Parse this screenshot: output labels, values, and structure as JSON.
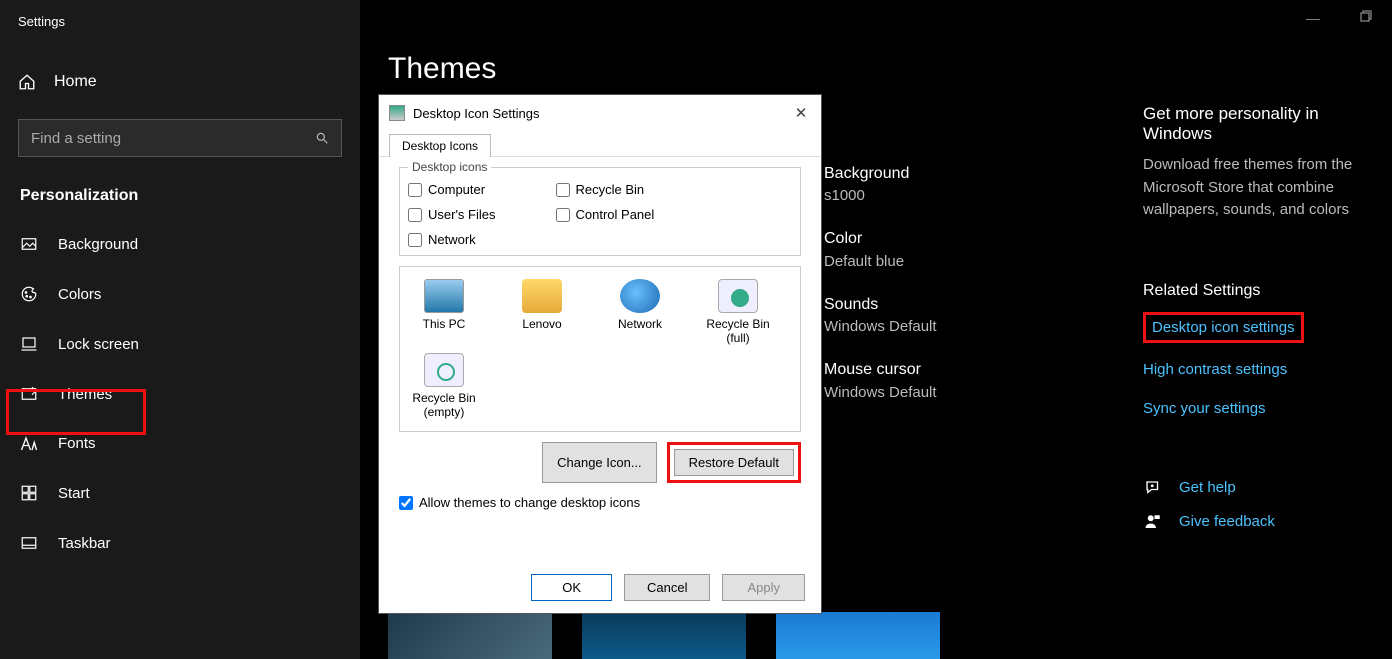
{
  "window": {
    "title": "Settings"
  },
  "sidebar": {
    "home": "Home",
    "search_placeholder": "Find a setting",
    "section": "Personalization",
    "items": [
      {
        "label": "Background"
      },
      {
        "label": "Colors"
      },
      {
        "label": "Lock screen"
      },
      {
        "label": "Themes"
      },
      {
        "label": "Fonts"
      },
      {
        "label": "Start"
      },
      {
        "label": "Taskbar"
      }
    ]
  },
  "page": {
    "title": "Themes",
    "details": [
      {
        "label": "Background",
        "value": "s1000"
      },
      {
        "label": "Color",
        "value": "Default blue"
      },
      {
        "label": "Sounds",
        "value": "Windows Default"
      },
      {
        "label": "Mouse cursor",
        "value": "Windows Default"
      }
    ]
  },
  "right": {
    "more_head": "Get more personality in Windows",
    "more_text": "Download free themes from the Microsoft Store that combine wallpapers, sounds, and colors",
    "related_head": "Related Settings",
    "links": [
      "Desktop icon settings",
      "High contrast settings",
      "Sync your settings"
    ],
    "help": "Get help",
    "feedback": "Give feedback"
  },
  "dialog": {
    "title": "Desktop Icon Settings",
    "tab": "Desktop Icons",
    "group": "Desktop icons",
    "checks_left": [
      "Computer",
      "User's Files",
      "Network"
    ],
    "checks_right": [
      "Recycle Bin",
      "Control Panel"
    ],
    "preview": [
      {
        "label": "This PC",
        "type": "pc"
      },
      {
        "label": "Lenovo",
        "type": "folder"
      },
      {
        "label": "Network",
        "type": "net"
      },
      {
        "label": "Recycle Bin (full)",
        "type": "binfull"
      },
      {
        "label": "Recycle Bin (empty)",
        "type": "bin"
      }
    ],
    "change_icon": "Change Icon...",
    "restore": "Restore Default",
    "allow": "Allow themes to change desktop icons",
    "ok": "OK",
    "cancel": "Cancel",
    "apply": "Apply"
  }
}
